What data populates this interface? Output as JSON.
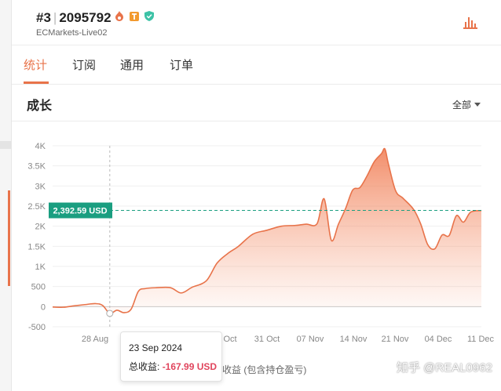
{
  "account": {
    "rank": "#3",
    "id": "2095792",
    "server": "ECMarkets-Live02",
    "badges": [
      "flame-badge-icon",
      "t-badge-icon",
      "verified-shield-icon"
    ]
  },
  "tabs": [
    {
      "label": "统计",
      "active": true
    },
    {
      "label": "订阅",
      "active": false
    },
    {
      "label": "通用",
      "active": false
    },
    {
      "label": "订单",
      "active": false
    }
  ],
  "section": {
    "title": "成长",
    "filter_label": "全部"
  },
  "colors": {
    "accent": "#e8734a",
    "line": "#e8734a",
    "reference": "#1a9e80",
    "negative": "#e0455d"
  },
  "chart_data": {
    "type": "area",
    "y_ticks": [
      "4K",
      "3.5K",
      "3K",
      "2.5K",
      "2K",
      "1.5K",
      "1K",
      "500",
      "0",
      "-500"
    ],
    "ylim": [
      -500,
      4000
    ],
    "x_ticks": [
      "28 Aug",
      "Oct",
      "31 Oct",
      "07 Nov",
      "14 Nov",
      "21 Nov",
      "04 Dec",
      "11 Dec"
    ],
    "xlim": [
      "2024-08-15",
      "2024-12-13"
    ],
    "grid": true,
    "reference_line": {
      "value": 2392.59,
      "label": "2,392.59 USD"
    },
    "crosshair_x": "2024-08-31",
    "series": [
      {
        "points": [
          [
            "2024-08-15",
            -10
          ],
          [
            "2024-08-18",
            -15
          ],
          [
            "2024-08-21",
            20
          ],
          [
            "2024-08-24",
            50
          ],
          [
            "2024-08-27",
            75
          ],
          [
            "2024-08-29",
            30
          ],
          [
            "2024-08-31",
            -168
          ],
          [
            "2024-09-02",
            -90
          ],
          [
            "2024-09-04",
            -150
          ],
          [
            "2024-09-06",
            -60
          ],
          [
            "2024-09-08",
            380
          ],
          [
            "2024-09-10",
            450
          ],
          [
            "2024-09-13",
            470
          ],
          [
            "2024-09-17",
            470
          ],
          [
            "2024-09-20",
            340
          ],
          [
            "2024-09-23",
            480
          ],
          [
            "2024-09-27",
            640
          ],
          [
            "2024-09-30",
            1080
          ],
          [
            "2024-10-03",
            1320
          ],
          [
            "2024-10-06",
            1500
          ],
          [
            "2024-10-10",
            1800
          ],
          [
            "2024-10-14",
            1900
          ],
          [
            "2024-10-18",
            2000
          ],
          [
            "2024-10-22",
            2020
          ],
          [
            "2024-10-25",
            2050
          ],
          [
            "2024-10-28",
            2060
          ],
          [
            "2024-10-30",
            2680
          ],
          [
            "2024-11-01",
            1650
          ],
          [
            "2024-11-03",
            2050
          ],
          [
            "2024-11-05",
            2440
          ],
          [
            "2024-11-07",
            2900
          ],
          [
            "2024-11-09",
            2960
          ],
          [
            "2024-11-11",
            3250
          ],
          [
            "2024-11-13",
            3600
          ],
          [
            "2024-11-15",
            3800
          ],
          [
            "2024-11-16",
            3920
          ],
          [
            "2024-11-17",
            3540
          ],
          [
            "2024-11-19",
            2880
          ],
          [
            "2024-11-21",
            2700
          ],
          [
            "2024-11-24",
            2420
          ],
          [
            "2024-11-26",
            2060
          ],
          [
            "2024-11-28",
            1540
          ],
          [
            "2024-11-30",
            1440
          ],
          [
            "2024-12-02",
            1780
          ],
          [
            "2024-12-04",
            1770
          ],
          [
            "2024-12-06",
            2260
          ],
          [
            "2024-12-08",
            2100
          ],
          [
            "2024-12-10",
            2350
          ],
          [
            "2024-12-13",
            2390
          ]
        ]
      }
    ],
    "tooltip": {
      "date": "23 Sep 2024",
      "label": "总收益:",
      "value": "-167.99 USD"
    },
    "legend": "收益 (包含持仓盈亏)"
  },
  "watermark": "知乎 @REAL0962"
}
